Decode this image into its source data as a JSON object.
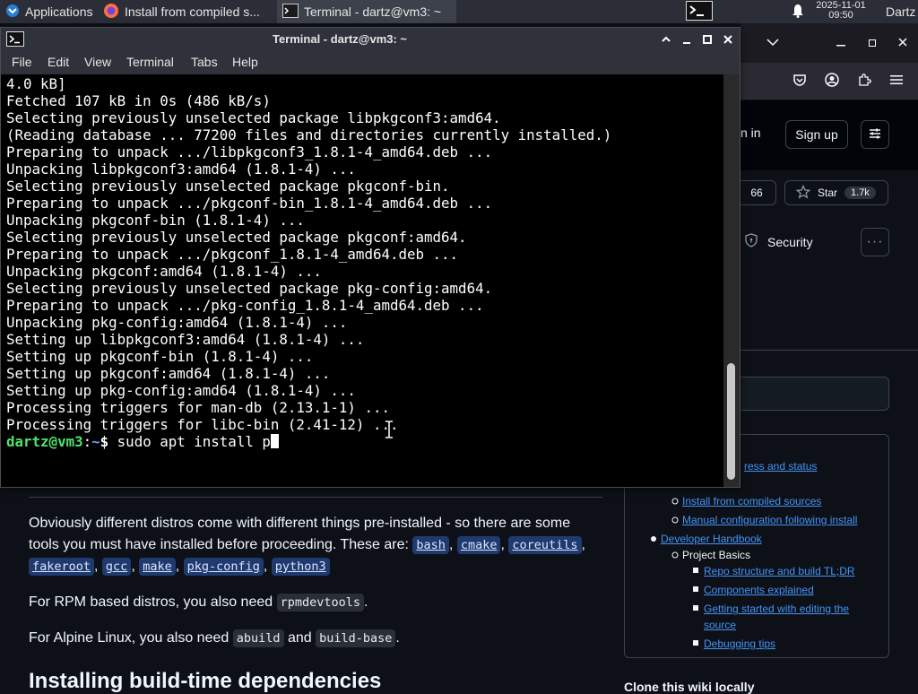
{
  "panel": {
    "apps_label": "Applications",
    "win1_label": "Install from compiled s...",
    "win2_label": "Terminal - dartz@vm3: ~",
    "datetime_date": "2025-11-01",
    "datetime_time": "09:50",
    "user": "Dartz"
  },
  "browser": {
    "sign_in_partial": "n in",
    "sign_up_label": "Sign up",
    "watch_count": "66",
    "star_label": "Star",
    "star_count": "1.7k",
    "security_label": "Security"
  },
  "terminal": {
    "title": "Terminal - dartz@vm3: ~",
    "menu": [
      "File",
      "Edit",
      "View",
      "Terminal",
      "Tabs",
      "Help"
    ],
    "lines": [
      "4.0 kB]",
      "Fetched 107 kB in 0s (486 kB/s)",
      "Selecting previously unselected package libpkgconf3:amd64.",
      "(Reading database ... 77200 files and directories currently installed.)",
      "Preparing to unpack .../libpkgconf3_1.8.1-4_amd64.deb ...",
      "Unpacking libpkgconf3:amd64 (1.8.1-4) ...",
      "Selecting previously unselected package pkgconf-bin.",
      "Preparing to unpack .../pkgconf-bin_1.8.1-4_amd64.deb ...",
      "Unpacking pkgconf-bin (1.8.1-4) ...",
      "Selecting previously unselected package pkgconf:amd64.",
      "Preparing to unpack .../pkgconf_1.8.1-4_amd64.deb ...",
      "Unpacking pkgconf:amd64 (1.8.1-4) ...",
      "Selecting previously unselected package pkg-config:amd64.",
      "Preparing to unpack .../pkg-config_1.8.1-4_amd64.deb ...",
      "Unpacking pkg-config:amd64 (1.8.1-4) ...",
      "Setting up libpkgconf3:amd64 (1.8.1-4) ...",
      "Setting up pkgconf-bin (1.8.1-4) ...",
      "Setting up pkgconf:amd64 (1.8.1-4) ...",
      "Setting up pkg-config:amd64 (1.8.1-4) ...",
      "Processing triggers for man-db (2.13.1-1) ...",
      "Processing triggers for libc-bin (2.41-12) ..."
    ],
    "prompt_user": "dartz@vm3",
    "prompt_sep": ":",
    "prompt_path": "~",
    "prompt_dollar": "$",
    "command": " sudo apt install p"
  },
  "wiki": {
    "intro_1": "Obviously different distros come with different things pre-installed - so there are some",
    "intro_2": "tools you must have installed before proceeding. These are:",
    "tools": [
      "bash",
      "cmake",
      "coreutils",
      "fakeroot",
      "gcc",
      "make",
      "pkg-config",
      "python3"
    ],
    "rpm_prefix": "For RPM based distros, you also need",
    "rpm_tool": "rpmdevtools",
    "alpine_prefix": "For Alpine Linux, you also need",
    "alpine_tool1": "abuild",
    "alpine_and": "and",
    "alpine_tool2": "build-base",
    "heading": "Installing build-time dependencies"
  },
  "toc": {
    "item_progress": "ress and status",
    "item_compiled": "Install from compiled sources",
    "item_manual": "Manual configuration following install",
    "item_dev": "Developer Handbook",
    "item_basics": "Project Basics",
    "item_repo": "Repo structure and build TL;DR",
    "item_components": "Components explained",
    "item_editing_1": "Getting started with editing the",
    "item_editing_2": "source",
    "item_debugging": "Debugging tips",
    "clone_partial": "Clone this wiki locally"
  }
}
